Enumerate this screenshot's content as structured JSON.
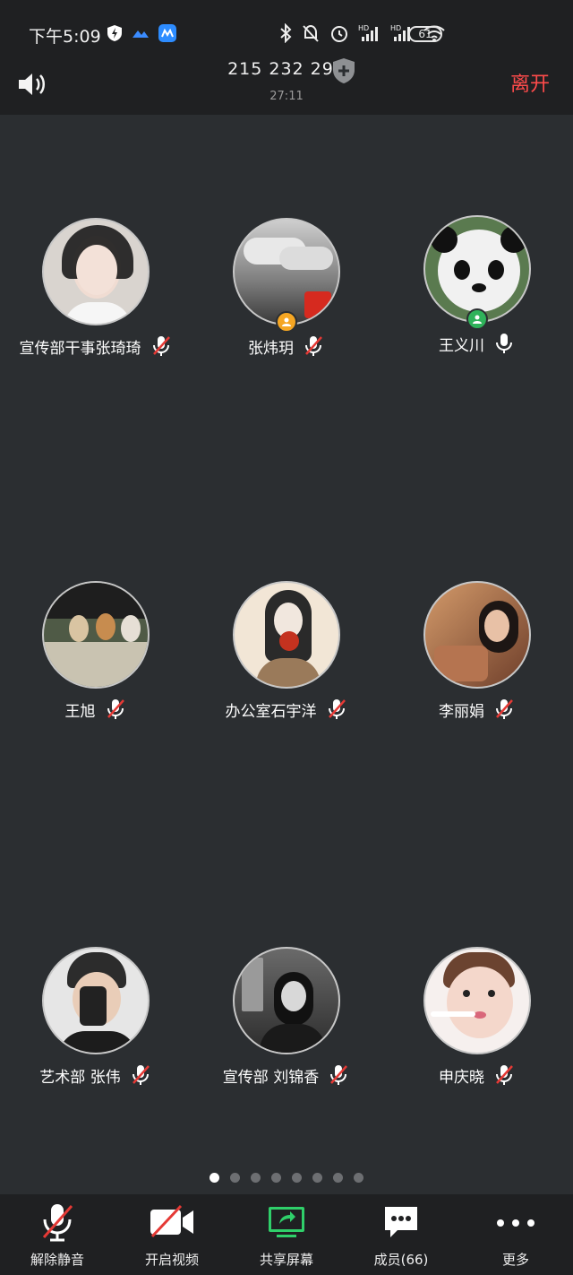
{
  "status_bar": {
    "time": "下午5:09",
    "battery": "61",
    "left_icons": [
      "shield-bolt-icon",
      "app-cloud-icon",
      "app-meeting-icon"
    ],
    "right_icons": [
      "bluetooth-icon",
      "bell-off-icon",
      "alarm-icon",
      "signal-hd-icon",
      "signal-hd-icon",
      "wifi-icon"
    ]
  },
  "header": {
    "meeting_id": "215 232 292",
    "timer": "27:11",
    "leave_label": "离开",
    "speaker_icon": "speaker-icon",
    "security_icon": "shield-plus-icon"
  },
  "participants": [
    {
      "name": "宣传部干事张琦琦",
      "mic": "muted",
      "badge": null,
      "avatar_color": "#d9d4cf"
    },
    {
      "name": "张炜玥",
      "mic": "muted",
      "badge": "host",
      "avatar_color": "#9a9a9a"
    },
    {
      "name": "王义川",
      "mic": "on",
      "badge": "cohost",
      "avatar_color": "#e9ece9"
    },
    {
      "name": "王旭",
      "mic": "muted",
      "badge": null,
      "avatar_color": "#6b6e5c"
    },
    {
      "name": "办公室石宇洋",
      "mic": "muted",
      "badge": null,
      "avatar_color": "#efe1cf"
    },
    {
      "name": "李丽娟",
      "mic": "muted",
      "badge": null,
      "avatar_color": "#9b6a50"
    },
    {
      "name": "艺术部 张伟",
      "mic": "muted",
      "badge": null,
      "avatar_color": "#e4e4e4"
    },
    {
      "name": "宣传部 刘锦香",
      "mic": "muted",
      "badge": null,
      "avatar_color": "#5a5a5a"
    },
    {
      "name": "申庆晓",
      "mic": "muted",
      "badge": null,
      "avatar_color": "#f1d8cd"
    }
  ],
  "pager": {
    "total": 8,
    "current": 1
  },
  "toolbar": {
    "unmute_label": "解除静音",
    "video_label": "开启视频",
    "share_label": "共享屏幕",
    "members_label": "成员(66)",
    "more_label": "更多"
  },
  "colors": {
    "background": "#2b2e31",
    "bar": "#1f2022",
    "leave": "#ff4b4b",
    "share_green": "#2fcf6a",
    "mute_red": "#e53935",
    "host_badge": "#f5a623",
    "cohost_badge": "#2fb25a"
  }
}
